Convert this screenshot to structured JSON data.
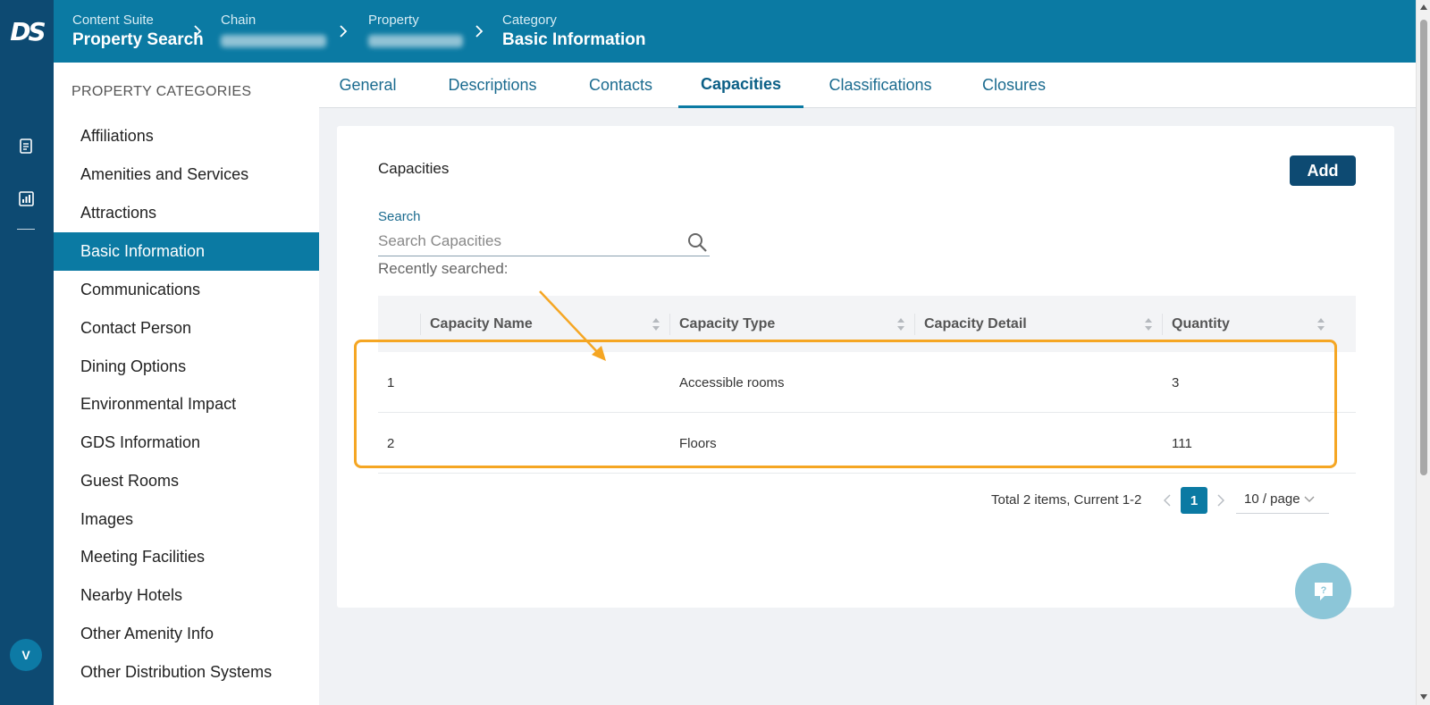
{
  "app": {
    "logo_text": "DS",
    "avatar_initial": "V"
  },
  "breadcrumb": [
    {
      "label": "Content Suite",
      "value": "Property Search"
    },
    {
      "label": "Chain",
      "value": ""
    },
    {
      "label": "Property",
      "value": ""
    },
    {
      "label": "Category",
      "value": "Basic Information"
    }
  ],
  "categories": {
    "title": "PROPERTY CATEGORIES",
    "items": [
      "Affiliations",
      "Amenities and Services",
      "Attractions",
      "Basic Information",
      "Communications",
      "Contact Person",
      "Dining Options",
      "Environmental Impact",
      "GDS Information",
      "Guest Rooms",
      "Images",
      "Meeting Facilities",
      "Nearby Hotels",
      "Other Amenity Info",
      "Other Distribution Systems"
    ],
    "active": "Basic Information"
  },
  "tabs": [
    "General",
    "Descriptions",
    "Contacts",
    "Capacities",
    "Classifications",
    "Closures"
  ],
  "active_tab": "Capacities",
  "panel": {
    "heading": "Capacities",
    "add_label": "Add",
    "search_label": "Search",
    "search_placeholder": "Search Capacities",
    "recently_searched": "Recently searched:"
  },
  "table": {
    "columns": [
      "",
      "Capacity Name",
      "Capacity Type",
      "Capacity Detail",
      "Quantity"
    ],
    "rows": [
      [
        "1",
        "",
        "Accessible rooms",
        "",
        "3"
      ],
      [
        "2",
        "",
        "Floors",
        "",
        "111"
      ]
    ]
  },
  "pagination": {
    "total_text": "Total 2 items, Current 1-2",
    "current_page": "1",
    "page_size": "10 / page"
  },
  "colors": {
    "header": "#0b7aa3",
    "rail": "#0d4a72",
    "highlight": "#f5a623"
  },
  "icons": [
    "document-icon",
    "chart-icon",
    "search-icon",
    "help-chat-icon",
    "chevron-right-icon",
    "sort-icon"
  ]
}
